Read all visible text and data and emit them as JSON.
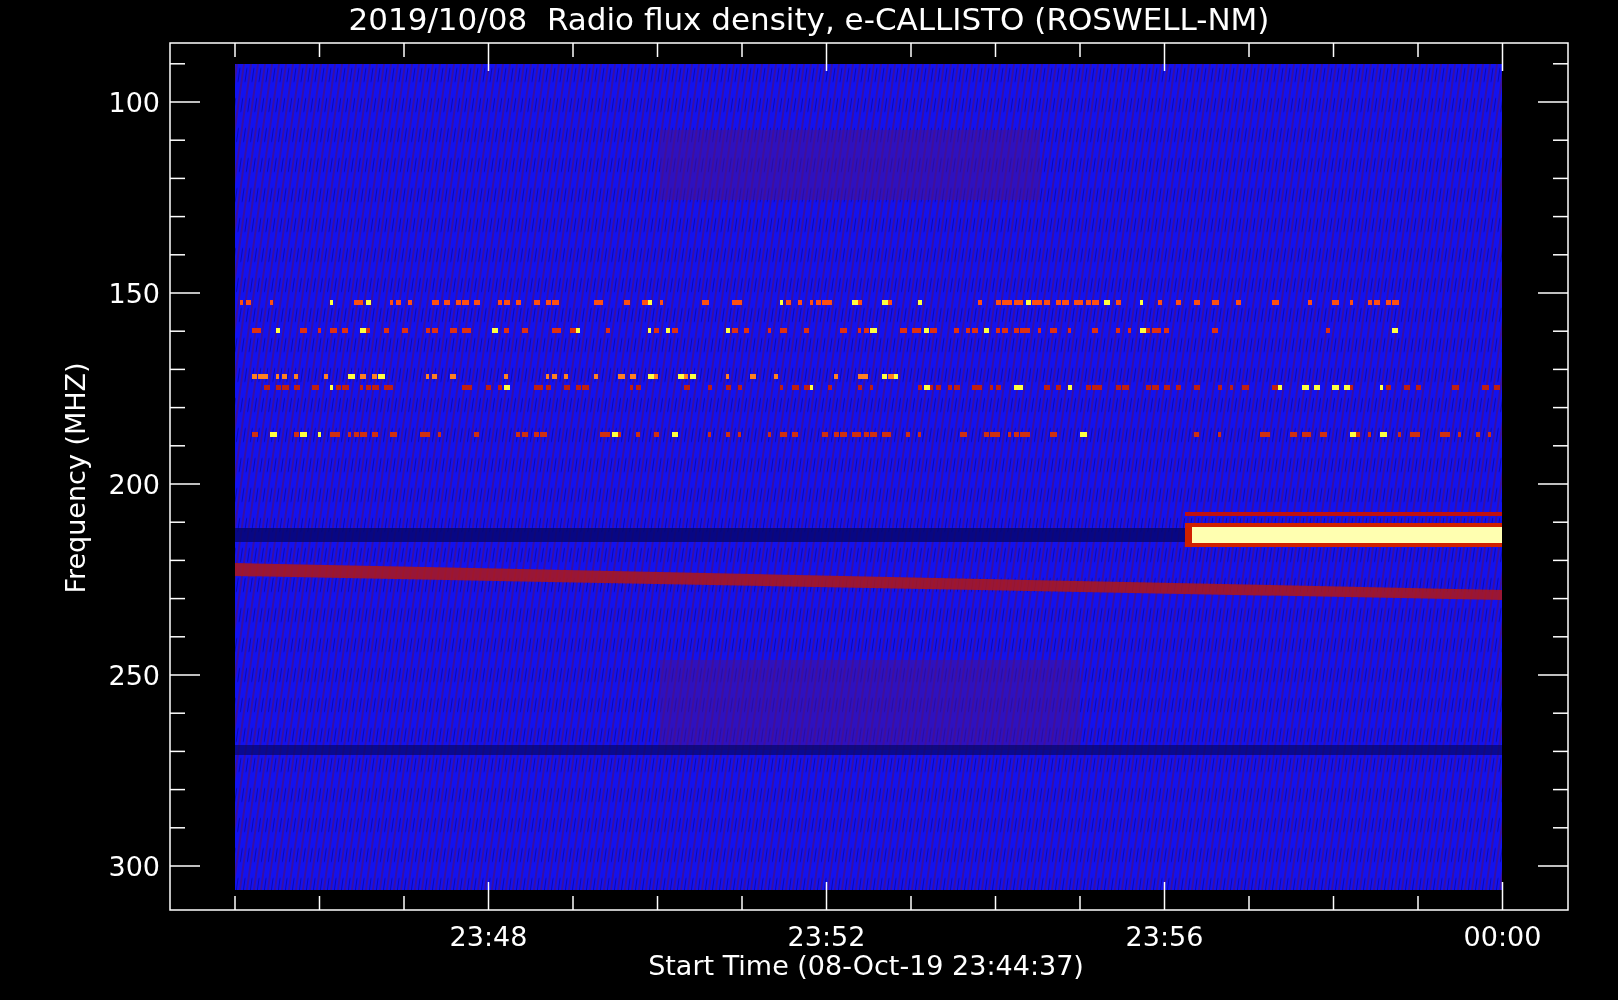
{
  "title": "2019/10/08  Radio flux density, e-CALLISTO (ROSWELL-NM)",
  "y_axis": {
    "label": "Frequency (MHZ)",
    "ticks": [
      "100",
      "150",
      "200",
      "250",
      "300"
    ]
  },
  "x_axis": {
    "label": "Start Time (08-Oct-19 23:44:37)",
    "ticks": [
      "23:48",
      "23:52",
      "23:56",
      "00:00"
    ]
  }
}
